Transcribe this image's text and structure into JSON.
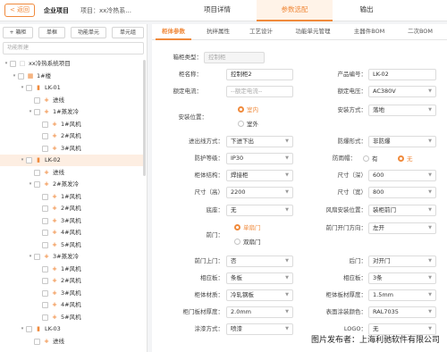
{
  "topbar": {
    "back_label": "< 返回",
    "project_label": "企业项目",
    "project_name": "项目：xx冷热系...",
    "tabs": [
      "项目详情",
      "参数选配",
      "输出"
    ],
    "active_tab": 1
  },
  "toolbar": {
    "buttons": [
      "+ 箱柜",
      "单框",
      "功能单元",
      "单元组"
    ],
    "search_placeholder": "功能新建"
  },
  "tree": [
    {
      "label": "xx冷热系统项目",
      "level": 0,
      "icon": "system-icon",
      "caret": "▾",
      "sel": false
    },
    {
      "label": "1#楼",
      "level": 1,
      "icon": "building-icon",
      "caret": "▾",
      "sel": false
    },
    {
      "label": "LK-01",
      "level": 2,
      "icon": "cabinet-icon",
      "caret": "▾",
      "sel": false
    },
    {
      "label": "进线",
      "level": 3,
      "icon": "plus-icon",
      "caret": "",
      "sel": false
    },
    {
      "label": "1#蒸发冷",
      "level": 3,
      "icon": "plus-icon",
      "caret": "▾",
      "sel": false
    },
    {
      "label": "1#风机",
      "level": 4,
      "icon": "plus-icon",
      "caret": "",
      "sel": false
    },
    {
      "label": "2#风机",
      "level": 4,
      "icon": "plus-icon",
      "caret": "",
      "sel": false
    },
    {
      "label": "3#风机",
      "level": 4,
      "icon": "plus-icon",
      "caret": "",
      "sel": false
    },
    {
      "label": "LK-02",
      "level": 2,
      "icon": "cabinet-icon",
      "caret": "▾",
      "sel": true
    },
    {
      "label": "进线",
      "level": 3,
      "icon": "plus-icon",
      "caret": "",
      "sel": false
    },
    {
      "label": "2#蒸发冷",
      "level": 3,
      "icon": "plus-icon",
      "caret": "▾",
      "sel": false
    },
    {
      "label": "1#风机",
      "level": 4,
      "icon": "plus-icon",
      "caret": "",
      "sel": false
    },
    {
      "label": "2#风机",
      "level": 4,
      "icon": "plus-icon",
      "caret": "",
      "sel": false
    },
    {
      "label": "3#风机",
      "level": 4,
      "icon": "plus-icon",
      "caret": "",
      "sel": false
    },
    {
      "label": "4#风机",
      "level": 4,
      "icon": "plus-icon",
      "caret": "",
      "sel": false
    },
    {
      "label": "5#风机",
      "level": 4,
      "icon": "plus-icon",
      "caret": "",
      "sel": false
    },
    {
      "label": "3#蒸发冷",
      "level": 3,
      "icon": "plus-icon",
      "caret": "▾",
      "sel": false
    },
    {
      "label": "1#风机",
      "level": 4,
      "icon": "plus-icon",
      "caret": "",
      "sel": false
    },
    {
      "label": "2#风机",
      "level": 4,
      "icon": "plus-icon",
      "caret": "",
      "sel": false
    },
    {
      "label": "3#风机",
      "level": 4,
      "icon": "plus-icon",
      "caret": "",
      "sel": false
    },
    {
      "label": "4#风机",
      "level": 4,
      "icon": "plus-icon",
      "caret": "",
      "sel": false
    },
    {
      "label": "5#风机",
      "level": 4,
      "icon": "plus-icon",
      "caret": "",
      "sel": false
    },
    {
      "label": "LK-03",
      "level": 2,
      "icon": "cabinet-icon",
      "caret": "▾",
      "sel": false
    },
    {
      "label": "进线",
      "level": 3,
      "icon": "plus-icon",
      "caret": "",
      "sel": false
    }
  ],
  "sub_tabs": [
    "柜体参数",
    "抗绊属性",
    "工艺设计",
    "功能单元管理",
    "主器件BOM",
    "二次BOM"
  ],
  "active_sub_tab": 0,
  "form": {
    "cabinet_type": {
      "label": "箱柜类型：",
      "value": "控制柜"
    },
    "cabinet_name": {
      "label": "柜名称：",
      "value": "控制柜2"
    },
    "product_no": {
      "label": "产品编号：",
      "value": "LK-02"
    },
    "rated_current": {
      "label": "额定电流：",
      "placeholder": "--额定电流--"
    },
    "rated_voltage": {
      "label": "额定电压：",
      "value": "AC380V"
    },
    "install_position": {
      "label": "安装位置：",
      "options": [
        "室内",
        "室外"
      ],
      "selected": 0
    },
    "install_method": {
      "label": "安装方式：",
      "value": "落地"
    },
    "in_out_method": {
      "label": "进出线方式：",
      "value": "下进下出"
    },
    "protection_form": {
      "label": "防爆形式：",
      "value": "非防爆"
    },
    "protection_level": {
      "label": "防护等级：",
      "value": "IP30"
    },
    "rain_cover": {
      "label": "防雨帽：",
      "options": [
        "有",
        "无"
      ],
      "selected": 1
    },
    "cabinet_structure": {
      "label": "柜体结构：",
      "value": "焊接柜"
    },
    "size_depth": {
      "label": "尺寸（深）",
      "value": "600"
    },
    "size_height": {
      "label": "尺寸（高）",
      "value": "2200"
    },
    "size_width": {
      "label": "尺寸（宽）",
      "value": "800"
    },
    "base": {
      "label": "底座：",
      "value": "无"
    },
    "fan_position": {
      "label": "风扇安装位置：",
      "value": "装柜前门"
    },
    "front_door": {
      "label": "前门：",
      "options": [
        "单扇门",
        "双扇门"
      ],
      "selected": 0
    },
    "front_door_open": {
      "label": "前门开门方向：",
      "value": "左开"
    },
    "front_door_top": {
      "label": "前门上门：",
      "value": "否"
    },
    "rear_door": {
      "label": "后门：",
      "value": "对开门"
    },
    "top_plate": {
      "label": "相应板：",
      "value": "条板"
    },
    "side_plate": {
      "label": "相应板：",
      "value": "3条"
    },
    "cabinet_material": {
      "label": "柜体材质：",
      "value": "冷轧钢板"
    },
    "cabinet_thickness": {
      "label": "柜体板材厚度：",
      "value": "1.5mm"
    },
    "door_thickness": {
      "label": "柜门板材厚度：",
      "value": "2.0mm"
    },
    "surface_color": {
      "label": "表面涂装颜色：",
      "value": "RAL7035"
    },
    "paint_method": {
      "label": "涂漆方式：",
      "value": "喷漆"
    },
    "logo": {
      "label": "LOGO：",
      "value": "无"
    }
  },
  "watermark": "图片发布者：上海利驰软件有限公司",
  "colors": {
    "accent": "#f08a3c",
    "accent_light": "#fff3e8",
    "selected_row": "#fdeee2"
  }
}
